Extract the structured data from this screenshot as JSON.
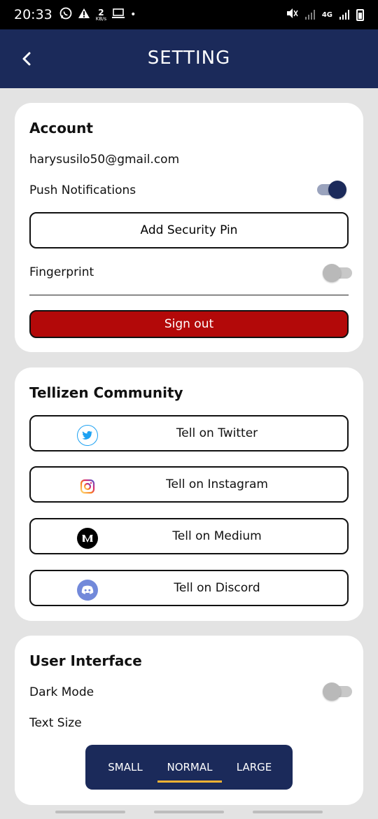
{
  "status_bar": {
    "time": "20:33",
    "icons": [
      "whatsapp-icon",
      "warning-icon",
      "data-speed-icon",
      "cast-icon",
      "dot-icon"
    ],
    "data_speed_value": "2",
    "data_speed_unit": "KB/s",
    "network_label": "4G",
    "right_icons": [
      "mute-icon",
      "signal-icon",
      "4g-icon",
      "signal-icon",
      "battery-icon"
    ]
  },
  "appbar": {
    "title": "SETTING",
    "back_icon": "back-arrow-icon"
  },
  "account": {
    "heading": "Account",
    "email": "harysusilo50@gmail.com",
    "push_label": "Push Notifications",
    "push_on": true,
    "security_pin_label": "Add Security Pin",
    "fingerprint_label": "Fingerprint",
    "fingerprint_on": false,
    "signout_label": "Sign out"
  },
  "community": {
    "heading": "Tellizen Community",
    "buttons": [
      {
        "label": "Tell on Twitter",
        "icon": "twitter-icon",
        "color": "#1da1f2"
      },
      {
        "label": "Tell on Instagram",
        "icon": "instagram-icon",
        "color": "#d62976"
      },
      {
        "label": "Tell on Medium",
        "icon": "medium-icon",
        "color": "#000000"
      },
      {
        "label": "Tell on Discord",
        "icon": "discord-icon",
        "color": "#7289da"
      }
    ]
  },
  "ui": {
    "heading": "User Interface",
    "dark_mode_label": "Dark Mode",
    "dark_mode_on": false,
    "text_size_label": "Text Size",
    "sizes": [
      "SMALL",
      "NORMAL",
      "LARGE"
    ],
    "selected_size": "NORMAL"
  },
  "colors": {
    "primary": "#1b2a5a",
    "danger": "#b30909",
    "accent": "#f2b233"
  }
}
